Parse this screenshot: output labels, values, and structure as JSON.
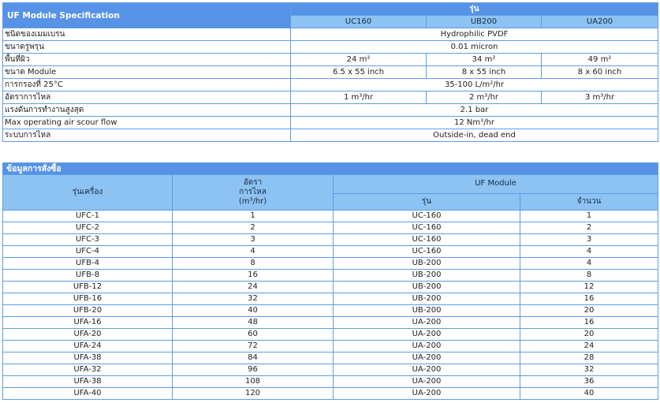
{
  "spec": {
    "title": "UF Module Specification",
    "model_header": "รุ่น",
    "models": [
      "UC160",
      "UB200",
      "UA200"
    ],
    "rows": [
      {
        "label": "ชนิดของเมมเบรน",
        "span": "Hydrophilic PVDF"
      },
      {
        "label": "ขนาดรูพรุน",
        "span": "0.01 micron"
      },
      {
        "label": "พื้นที่ผิว",
        "values": [
          "24 m²",
          "34 m²",
          "49 m²"
        ]
      },
      {
        "label": "ขนาด Module",
        "values": [
          "6.5 x 55 inch",
          "8 x 55 inch",
          "8 x 60 inch"
        ]
      },
      {
        "label": "การกรองที่ 25°C",
        "span": "35-100 L/m²/hr"
      },
      {
        "label": "อัตราการไหล",
        "values": [
          "1 m³/hr",
          "2 m³/hr",
          "3 m³/hr"
        ]
      },
      {
        "label": "แรงดันการทำงานสูงสุด",
        "span": "2.1 bar"
      },
      {
        "label": "Max operating air scour flow",
        "span": "12 Nm³/hr"
      },
      {
        "label": "ระบบการไหล",
        "span": "Outside-in, dead end"
      }
    ]
  },
  "order": {
    "title": "ข้อมูลการสั่งซื้อ",
    "col_model": "รุ่นเครื่อง",
    "col_flow_line1": "อัตรา",
    "col_flow_line2": "การไหล",
    "col_flow_line3": "(m³/hr)",
    "col_uf": "UF Module",
    "col_uf_model": "รุ่น",
    "col_uf_qty": "จำนวน",
    "rows": [
      [
        "UFC-1",
        "1",
        "UC-160",
        "1"
      ],
      [
        "UFC-2",
        "2",
        "UC-160",
        "2"
      ],
      [
        "UFC-3",
        "3",
        "UC-160",
        "3"
      ],
      [
        "UFC-4",
        "4",
        "UC-160",
        "4"
      ],
      [
        "UFB-4",
        "8",
        "UB-200",
        "4"
      ],
      [
        "UFB-8",
        "16",
        "UB-200",
        "8"
      ],
      [
        "UFB-12",
        "24",
        "UB-200",
        "12"
      ],
      [
        "UFB-16",
        "32",
        "UB-200",
        "16"
      ],
      [
        "UFB-20",
        "40",
        "UB-200",
        "20"
      ],
      [
        "UFA-16",
        "48",
        "UA-200",
        "16"
      ],
      [
        "UFA-20",
        "60",
        "UA-200",
        "20"
      ],
      [
        "UFA-24",
        "72",
        "UA-200",
        "24"
      ],
      [
        "UFA-38",
        "84",
        "UA-200",
        "28"
      ],
      [
        "UFA-32",
        "96",
        "UA-200",
        "32"
      ],
      [
        "UFA-38",
        "108",
        "UA-200",
        "36"
      ],
      [
        "UFA-40",
        "120",
        "UA-200",
        "40"
      ]
    ]
  }
}
